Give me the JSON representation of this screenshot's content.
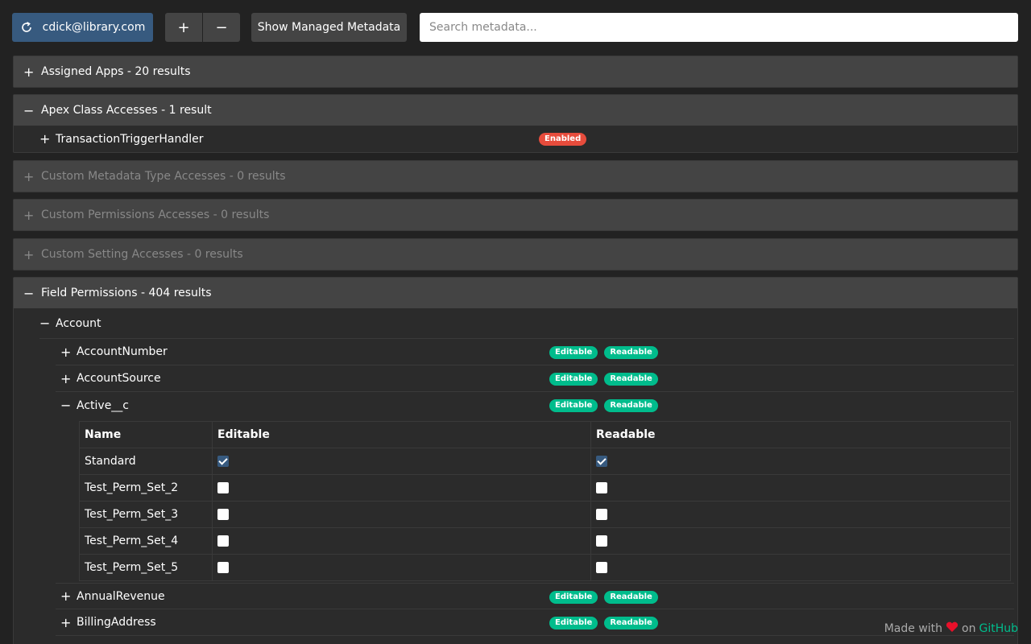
{
  "toolbar": {
    "user_label": "cdick@library.com",
    "expand_label": "+",
    "collapse_label": "−",
    "managed_label": "Show Managed Metadata",
    "search_placeholder": "Search metadata..."
  },
  "sections": {
    "assigned_apps": {
      "sign": "+",
      "title": "Assigned Apps - 20 results"
    },
    "apex": {
      "sign": "−",
      "title": "Apex Class Accesses - 1 result",
      "items": [
        {
          "sign": "+",
          "name": "TransactionTriggerHandler",
          "badge": "Enabled"
        }
      ]
    },
    "custom_metadata": {
      "sign": "+",
      "title": "Custom Metadata Type Accesses - 0 results"
    },
    "custom_permissions": {
      "sign": "+",
      "title": "Custom Permissions Accesses - 0 results"
    },
    "custom_setting": {
      "sign": "+",
      "title": "Custom Setting Accesses - 0 results"
    },
    "field_permissions": {
      "sign": "−",
      "title": "Field Permissions - 404 results",
      "object": {
        "sign": "−",
        "name": "Account"
      },
      "fields": [
        {
          "sign": "+",
          "name": "AccountNumber",
          "badge1": "Editable",
          "badge2": "Readable"
        },
        {
          "sign": "+",
          "name": "AccountSource",
          "badge1": "Editable",
          "badge2": "Readable"
        },
        {
          "sign": "−",
          "name": "Active__c",
          "badge1": "Editable",
          "badge2": "Readable"
        },
        {
          "sign": "+",
          "name": "AnnualRevenue",
          "badge1": "Editable",
          "badge2": "Readable"
        },
        {
          "sign": "+",
          "name": "BillingAddress",
          "badge1": "Editable",
          "badge2": "Readable"
        }
      ],
      "table": {
        "headers": [
          "Name",
          "Editable",
          "Readable"
        ],
        "rows": [
          {
            "name": "Standard",
            "editable": true,
            "readable": true
          },
          {
            "name": "Test_Perm_Set_2",
            "editable": false,
            "readable": false
          },
          {
            "name": "Test_Perm_Set_3",
            "editable": false,
            "readable": false
          },
          {
            "name": "Test_Perm_Set_4",
            "editable": false,
            "readable": false
          },
          {
            "name": "Test_Perm_Set_5",
            "editable": false,
            "readable": false
          }
        ]
      }
    }
  },
  "footer": {
    "made_with": "Made with",
    "on": "on",
    "link": "GitHub"
  },
  "colors": {
    "primary": "#375a7f",
    "success": "#00bc8c",
    "danger": "#e74c3c",
    "bg": "#222222"
  }
}
